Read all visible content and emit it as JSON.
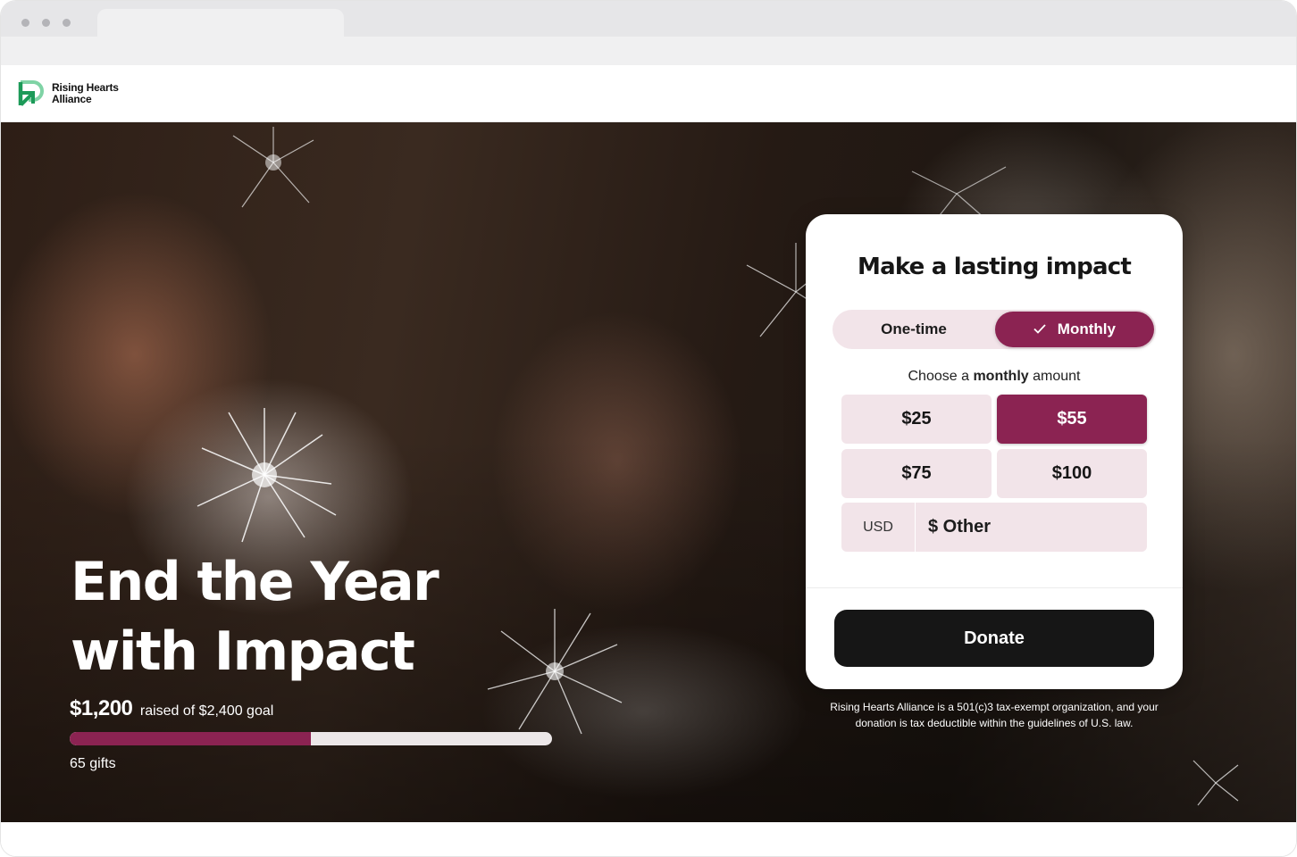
{
  "brand": {
    "name_line1": "Rising Hearts",
    "name_line2": "Alliance",
    "logo_icon": "arrow-logo-icon",
    "colors": {
      "accent": "#8b2352",
      "accent_light": "#f2e4e9",
      "logo_green": "#1c9a58",
      "dark": "#161616"
    }
  },
  "hero": {
    "title_line1": "End the Year",
    "title_line2": "with Impact",
    "raised_amount": "$1,200",
    "raised_rest": "raised of $2,400 goal",
    "progress_percent": 50,
    "gifts": "65 gifts"
  },
  "donation_card": {
    "title": "Make a lasting impact",
    "frequency": {
      "one_time_label": "One-time",
      "monthly_label": "Monthly",
      "selected": "Monthly"
    },
    "caption_prefix": "Choose a",
    "caption_bold": "monthly",
    "caption_suffix": "amount",
    "amounts": [
      "$25",
      "$55",
      "$75",
      "$100"
    ],
    "selected_amount": "$55",
    "currency": "USD",
    "other_label": "$ Other",
    "donate_label": "Donate"
  },
  "disclaimer": "Rising Hearts Alliance is a 501(c)3 tax-exempt organization, and your donation is tax deductible within the guidelines of U.S. law."
}
